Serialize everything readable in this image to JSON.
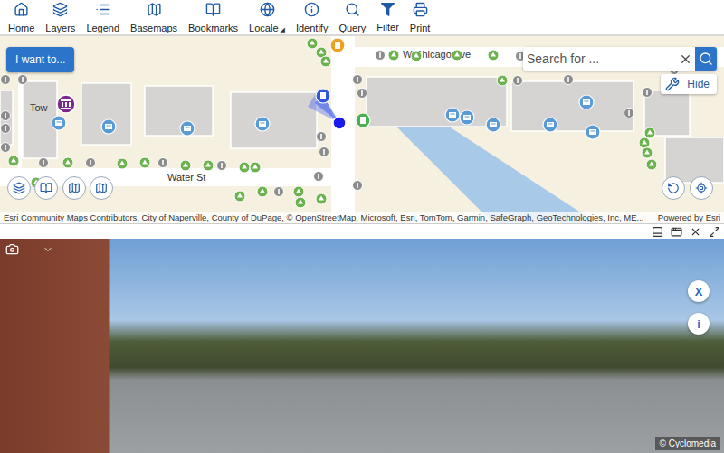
{
  "toolbar": [
    {
      "label": "Home",
      "caret": ""
    },
    {
      "label": "Layers",
      "caret": ""
    },
    {
      "label": "Legend",
      "caret": ""
    },
    {
      "label": "Basemaps",
      "caret": ""
    },
    {
      "label": "Bookmarks",
      "caret": ""
    },
    {
      "label": "Locale",
      "caret": "◢"
    },
    {
      "label": "Identify",
      "caret": ""
    },
    {
      "label": "Query",
      "caret": ""
    },
    {
      "label": "Filter",
      "caret": ""
    },
    {
      "label": "Print",
      "caret": ""
    }
  ],
  "map": {
    "i_want_to": "I want to...",
    "search": {
      "placeholder": "Search for ..."
    },
    "hide_button": "Hide",
    "street_labels": [
      {
        "text": "W Chicago Ave"
      },
      {
        "text": "Water St"
      },
      {
        "text": "Tow"
      }
    ],
    "attribution": "Esri Community Maps Contributors, City of Naperville, County of DuPage, © OpenStreetMap, Microsoft, Esri, TomTom, Garmin, SafeGraph, GeoTechnologies, Inc, ME...",
    "powered_by": "Powered by Esri"
  },
  "street_view": {
    "close": "X",
    "info": "i",
    "credit": "© Cyclomedia"
  }
}
